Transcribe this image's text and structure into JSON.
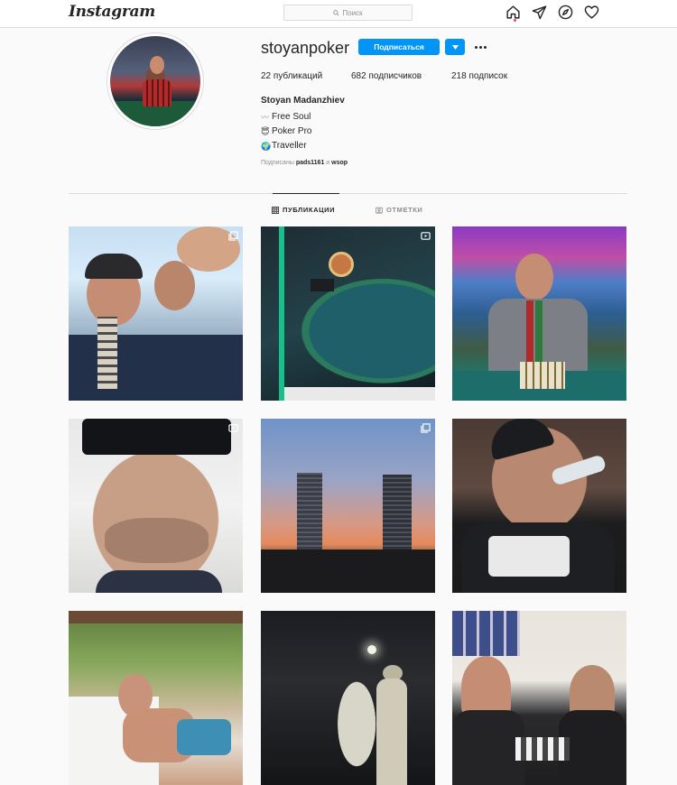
{
  "nav": {
    "logo": "Instagram",
    "search_placeholder": "Поиск",
    "icons": [
      "home-icon",
      "direct-icon",
      "explore-icon",
      "activity-heart-icon"
    ]
  },
  "profile": {
    "username": "stoyanpoker",
    "follow_label": "Подписаться",
    "stats": {
      "posts": "22 публикаций",
      "followers": "682 подписчиков",
      "following": "218 подписок"
    },
    "full_name": "Stoyan Madanzhiev",
    "bio": [
      {
        "glyph": "〰",
        "text": "Free Soul"
      },
      {
        "glyph": "😇",
        "text": "Poker Pro"
      },
      {
        "glyph": "🌍",
        "text": "Traveller"
      }
    ],
    "followed_by": {
      "prefix": "Подписаны",
      "user1": "pads1161",
      "joiner": "и",
      "user2": "wsop"
    }
  },
  "tabs": {
    "posts": "ПУБЛИКАЦИИ",
    "tagged": "ОТМЕТКИ"
  },
  "grid": [
    {
      "subject": "friends-skiing",
      "type": "carousel"
    },
    {
      "subject": "poker-table-screenshot",
      "type": "video"
    },
    {
      "subject": "tournament-win-trophy",
      "type": "photo"
    },
    {
      "subject": "selfie-sunglasses",
      "type": "video"
    },
    {
      "subject": "twin-towers-sunset",
      "type": "carousel"
    },
    {
      "subject": "man-drinking-water",
      "type": "photo"
    },
    {
      "subject": "man-lounging-terrace",
      "type": "photo"
    },
    {
      "subject": "statue-at-night",
      "type": "photo"
    },
    {
      "subject": "men-playing-chess",
      "type": "photo"
    }
  ],
  "colors": {
    "accent": "#0095f6",
    "text": "#262626",
    "muted": "#8e8e8e",
    "border": "#dbdbdb",
    "background": "#fafafa",
    "notification": "#ed4956"
  }
}
